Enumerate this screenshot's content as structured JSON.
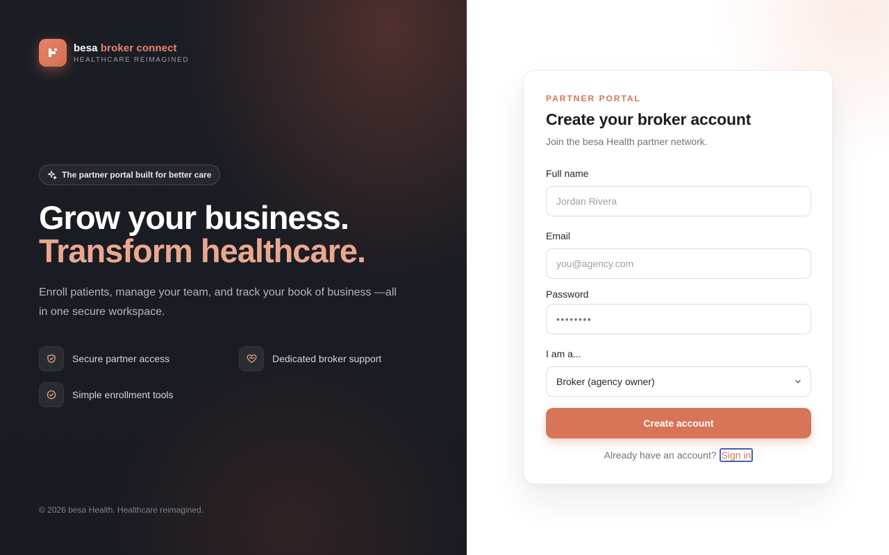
{
  "brand": {
    "name_part1": "besa",
    "name_part2": "broker connect",
    "tagline": "HEALTHCARE REIMAGINED"
  },
  "hero": {
    "pill": "The partner portal built for better care",
    "headline_line1": "Grow your business.",
    "headline_line2": "Transform healthcare.",
    "lead": "Enroll patients, manage your team, and track your book of business —all in one secure workspace.",
    "features": [
      {
        "icon": "shield-icon",
        "label": "Secure partner access"
      },
      {
        "icon": "heart-handshake-icon",
        "label": "Dedicated broker support"
      },
      {
        "icon": "check-circle-icon",
        "label": "Simple enrollment tools"
      }
    ]
  },
  "footer": {
    "copyright": "© 2026 besa Health. Healthcare reimagined."
  },
  "form": {
    "eyebrow": "PARTNER PORTAL",
    "title": "Create your broker account",
    "subtitle": "Join the besa Health partner network.",
    "full_name": {
      "label": "Full name",
      "placeholder": "Jordan Rivera"
    },
    "email": {
      "label": "Email",
      "placeholder": "you@agency.com"
    },
    "password": {
      "label": "Password",
      "value": "••••••••"
    },
    "role": {
      "label": "I am a...",
      "selected": "Broker (agency owner)"
    },
    "submit_label": "Create account",
    "signin_prompt": "Already have an account?",
    "signin_link": "Sign in"
  },
  "colors": {
    "accent": "#d87458",
    "accent_light": "#eba88f",
    "dark_bg": "#1b1d25"
  }
}
